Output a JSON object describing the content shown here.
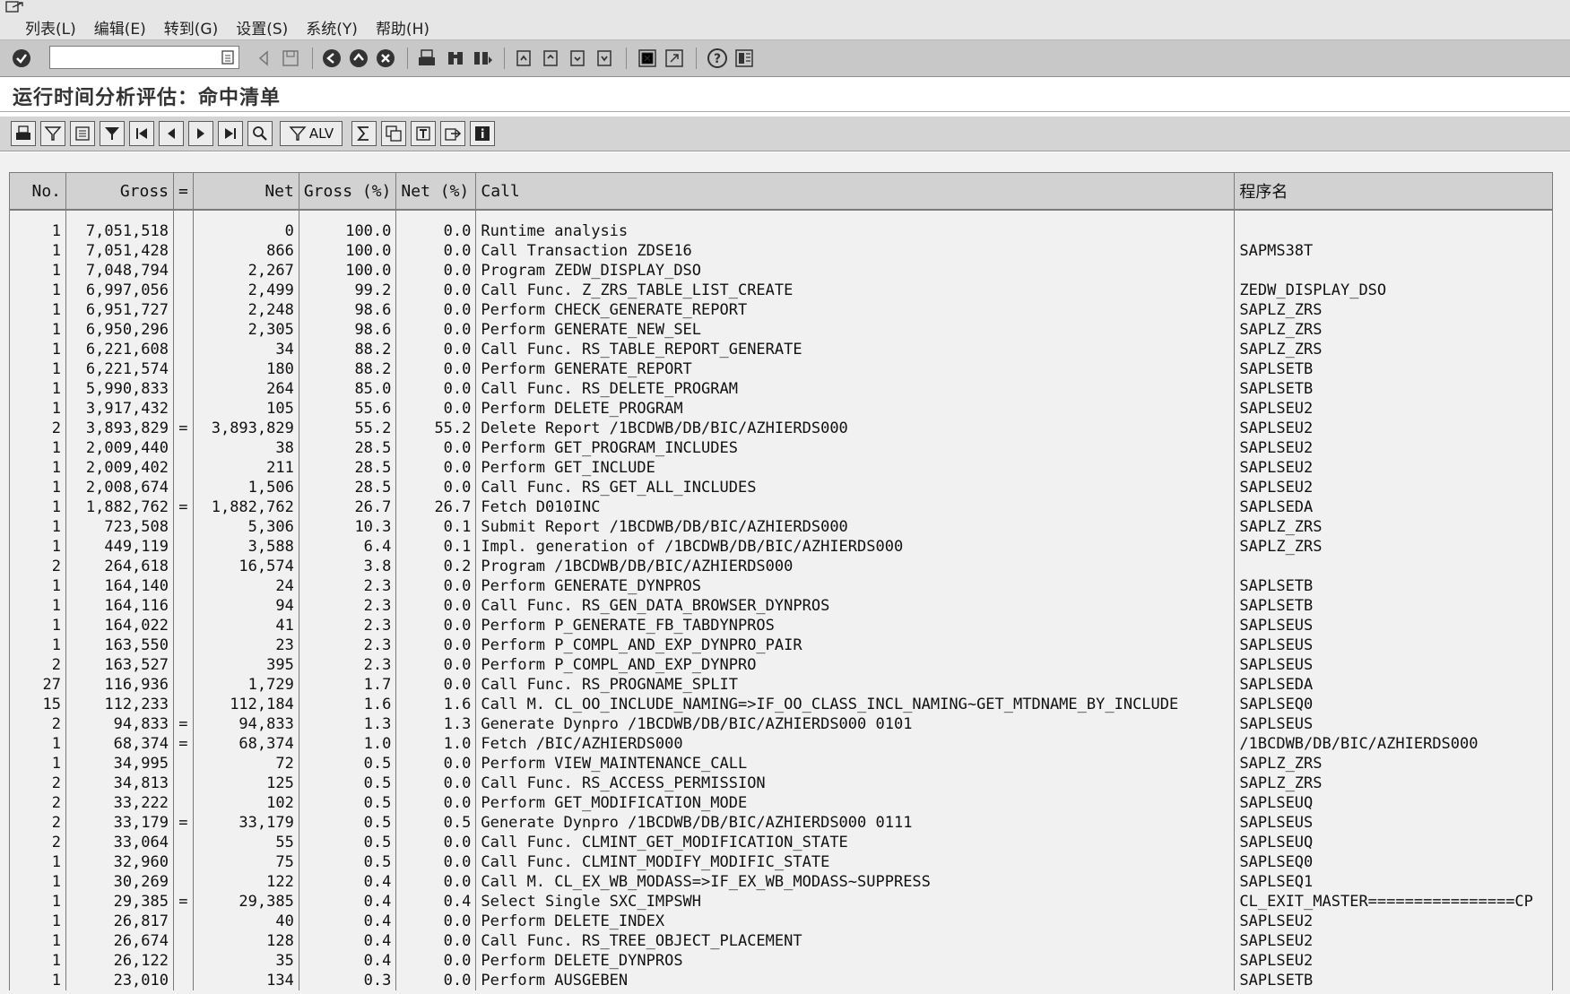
{
  "menu": {
    "items": [
      "列表(L)",
      "编辑(E)",
      "转到(G)",
      "设置(S)",
      "系统(Y)",
      "帮助(H)"
    ]
  },
  "system_toolbar": {
    "command_field": {
      "value": "",
      "placeholder": ""
    },
    "icons": [
      "enter-check-icon",
      "dropdown-history-icon",
      "back-arrow-icon",
      "save-icon",
      "back-icon",
      "exit-icon",
      "cancel-icon",
      "print-icon",
      "find-icon",
      "find-next-icon",
      "first-page-icon",
      "previous-page-icon",
      "next-page-icon",
      "last-page-icon",
      "create-session-icon",
      "shortcut-icon",
      "help-icon",
      "layout-menu-icon"
    ]
  },
  "screen": {
    "title": "运行时间分析评估：命中清单"
  },
  "alv_toolbar": {
    "alv_label": "ALV",
    "icons": [
      "print-icon",
      "filter-down-icon",
      "detail-icon",
      "set-filter-icon",
      "first-icon",
      "previous-icon",
      "next-icon",
      "last-icon",
      "find-icon",
      "alv-filter-icon",
      "sum-icon",
      "subtotal-icon",
      "top-icon",
      "export-icon",
      "info-icon"
    ]
  },
  "table": {
    "columns": [
      "No.",
      "Gross",
      "=",
      "Net",
      "Gross (%)",
      "Net (%)",
      "Call",
      "程序名"
    ],
    "rows": [
      [
        "1",
        "7,051,518",
        "",
        "0",
        "100.0",
        "0.0",
        "Runtime analysis",
        ""
      ],
      [
        "1",
        "7,051,428",
        "",
        "866",
        "100.0",
        "0.0",
        "Call Transaction ZDSE16",
        "SAPMS38T"
      ],
      [
        "1",
        "7,048,794",
        "",
        "2,267",
        "100.0",
        "0.0",
        "Program ZEDW_DISPLAY_DSO",
        ""
      ],
      [
        "1",
        "6,997,056",
        "",
        "2,499",
        "99.2",
        "0.0",
        "Call Func. Z_ZRS_TABLE_LIST_CREATE",
        "ZEDW_DISPLAY_DSO"
      ],
      [
        "1",
        "6,951,727",
        "",
        "2,248",
        "98.6",
        "0.0",
        "Perform CHECK_GENERATE_REPORT",
        "SAPLZ_ZRS"
      ],
      [
        "1",
        "6,950,296",
        "",
        "2,305",
        "98.6",
        "0.0",
        "Perform GENERATE_NEW_SEL",
        "SAPLZ_ZRS"
      ],
      [
        "1",
        "6,221,608",
        "",
        "34",
        "88.2",
        "0.0",
        "Call Func. RS_TABLE_REPORT_GENERATE",
        "SAPLZ_ZRS"
      ],
      [
        "1",
        "6,221,574",
        "",
        "180",
        "88.2",
        "0.0",
        "Perform GENERATE_REPORT",
        "SAPLSETB"
      ],
      [
        "1",
        "5,990,833",
        "",
        "264",
        "85.0",
        "0.0",
        "Call Func. RS_DELETE_PROGRAM",
        "SAPLSETB"
      ],
      [
        "1",
        "3,917,432",
        "",
        "105",
        "55.6",
        "0.0",
        "Perform DELETE_PROGRAM",
        "SAPLSEU2"
      ],
      [
        "2",
        "3,893,829",
        "=",
        "3,893,829",
        "55.2",
        "55.2",
        "Delete Report /1BCDWB/DB/BIC/AZHIERDS000",
        "SAPLSEU2"
      ],
      [
        "1",
        "2,009,440",
        "",
        "38",
        "28.5",
        "0.0",
        "Perform GET_PROGRAM_INCLUDES",
        "SAPLSEU2"
      ],
      [
        "1",
        "2,009,402",
        "",
        "211",
        "28.5",
        "0.0",
        "Perform GET_INCLUDE",
        "SAPLSEU2"
      ],
      [
        "1",
        "2,008,674",
        "",
        "1,506",
        "28.5",
        "0.0",
        "Call Func. RS_GET_ALL_INCLUDES",
        "SAPLSEU2"
      ],
      [
        "1",
        "1,882,762",
        "=",
        "1,882,762",
        "26.7",
        "26.7",
        "Fetch D010INC",
        "SAPLSEDA"
      ],
      [
        "1",
        "723,508",
        "",
        "5,306",
        "10.3",
        "0.1",
        "Submit Report /1BCDWB/DB/BIC/AZHIERDS000",
        "SAPLZ_ZRS"
      ],
      [
        "1",
        "449,119",
        "",
        "3,588",
        "6.4",
        "0.1",
        "Impl. generation of /1BCDWB/DB/BIC/AZHIERDS000",
        "SAPLZ_ZRS"
      ],
      [
        "2",
        "264,618",
        "",
        "16,574",
        "3.8",
        "0.2",
        "Program /1BCDWB/DB/BIC/AZHIERDS000",
        ""
      ],
      [
        "1",
        "164,140",
        "",
        "24",
        "2.3",
        "0.0",
        "Perform GENERATE_DYNPROS",
        "SAPLSETB"
      ],
      [
        "1",
        "164,116",
        "",
        "94",
        "2.3",
        "0.0",
        "Call Func. RS_GEN_DATA_BROWSER_DYNPROS",
        "SAPLSETB"
      ],
      [
        "1",
        "164,022",
        "",
        "41",
        "2.3",
        "0.0",
        "Perform P_GENERATE_FB_TABDYNPROS",
        "SAPLSEUS"
      ],
      [
        "1",
        "163,550",
        "",
        "23",
        "2.3",
        "0.0",
        "Perform P_COMPL_AND_EXP_DYNPRO_PAIR",
        "SAPLSEUS"
      ],
      [
        "2",
        "163,527",
        "",
        "395",
        "2.3",
        "0.0",
        "Perform P_COMPL_AND_EXP_DYNPRO",
        "SAPLSEUS"
      ],
      [
        "27",
        "116,936",
        "",
        "1,729",
        "1.7",
        "0.0",
        "Call Func. RS_PROGNAME_SPLIT",
        "SAPLSEDA"
      ],
      [
        "15",
        "112,233",
        "",
        "112,184",
        "1.6",
        "1.6",
        "Call M. CL_OO_INCLUDE_NAMING=>IF_OO_CLASS_INCL_NAMING~GET_MTDNAME_BY_INCLUDE",
        "SAPLSEQ0"
      ],
      [
        "2",
        "94,833",
        "=",
        "94,833",
        "1.3",
        "1.3",
        "Generate Dynpro /1BCDWB/DB/BIC/AZHIERDS000 0101",
        "SAPLSEUS"
      ],
      [
        "1",
        "68,374",
        "=",
        "68,374",
        "1.0",
        "1.0",
        "Fetch /BIC/AZHIERDS000",
        "/1BCDWB/DB/BIC/AZHIERDS000"
      ],
      [
        "1",
        "34,995",
        "",
        "72",
        "0.5",
        "0.0",
        "Perform VIEW_MAINTENANCE_CALL",
        "SAPLZ_ZRS"
      ],
      [
        "2",
        "34,813",
        "",
        "125",
        "0.5",
        "0.0",
        "Call Func. RS_ACCESS_PERMISSION",
        "SAPLZ_ZRS"
      ],
      [
        "2",
        "33,222",
        "",
        "102",
        "0.5",
        "0.0",
        "Perform GET_MODIFICATION_MODE",
        "SAPLSEUQ"
      ],
      [
        "2",
        "33,179",
        "=",
        "33,179",
        "0.5",
        "0.5",
        "Generate Dynpro /1BCDWB/DB/BIC/AZHIERDS000 0111",
        "SAPLSEUS"
      ],
      [
        "2",
        "33,064",
        "",
        "55",
        "0.5",
        "0.0",
        "Call Func. CLMINT_GET_MODIFICATION_STATE",
        "SAPLSEUQ"
      ],
      [
        "1",
        "32,960",
        "",
        "75",
        "0.5",
        "0.0",
        "Call Func. CLMINT_MODIFY_MODIFIC_STATE",
        "SAPLSEQ0"
      ],
      [
        "1",
        "30,269",
        "",
        "122",
        "0.4",
        "0.0",
        "Call M. CL_EX_WB_MODASS=>IF_EX_WB_MODASS~SUPPRESS",
        "SAPLSEQ1"
      ],
      [
        "1",
        "29,385",
        "=",
        "29,385",
        "0.4",
        "0.4",
        "Select Single SXC_IMPSWH",
        "CL_EXIT_MASTER================CP"
      ],
      [
        "1",
        "26,817",
        "",
        "40",
        "0.4",
        "0.0",
        "Perform DELETE_INDEX",
        "SAPLSEU2"
      ],
      [
        "1",
        "26,674",
        "",
        "128",
        "0.4",
        "0.0",
        "Call Func. RS_TREE_OBJECT_PLACEMENT",
        "SAPLSEU2"
      ],
      [
        "1",
        "26,122",
        "",
        "35",
        "0.4",
        "0.0",
        "Perform DELETE_DYNPROS",
        "SAPLSEU2"
      ],
      [
        "1",
        "23,010",
        "",
        "134",
        "0.3",
        "0.0",
        "Perform AUSGEBEN",
        "SAPLSETB"
      ]
    ]
  }
}
